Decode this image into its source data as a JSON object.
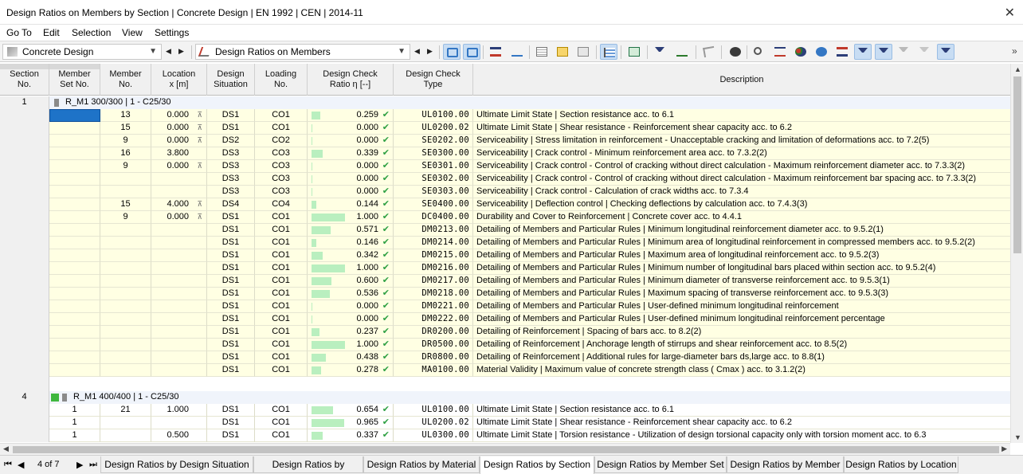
{
  "window": {
    "title": "Design Ratios on Members by Section | Concrete Design | EN 1992 | CEN | 2014-11",
    "close": "✕"
  },
  "menu": [
    "Go To",
    "Edit",
    "Selection",
    "View",
    "Settings"
  ],
  "toolbar": {
    "module": "Concrete Design",
    "result_table": "Design Ratios on Members",
    "overflow": "»"
  },
  "columns": {
    "section": [
      "Section",
      "No."
    ],
    "member_set": [
      "Member",
      "Set No."
    ],
    "member": [
      "Member",
      "No."
    ],
    "location": [
      "Location",
      "x [m]"
    ],
    "design_situation": [
      "Design",
      "Situation"
    ],
    "loading": [
      "Loading",
      "No."
    ],
    "ratio": [
      "Design Check",
      "Ratio η [--]"
    ],
    "type": [
      "Design Check",
      "Type"
    ],
    "description": "Description"
  },
  "groups": [
    {
      "section": "1",
      "label": "R_M1 300/300 | 1 - C25/30",
      "color": ""
    },
    {
      "section": "4",
      "label": "R_M1 400/400 | 1 - C25/30",
      "color": "#3fb73f"
    }
  ],
  "rows_g1": [
    {
      "set": "",
      "member": "13",
      "x": "0.000",
      "xm": "⊼",
      "ds": "DS1",
      "lo": "CO1",
      "ratio": 0.259,
      "r": "0.259",
      "type": "UL0100.00",
      "desc": "Ultimate Limit State | Section resistance acc. to 6.1"
    },
    {
      "set": "",
      "member": "15",
      "x": "0.000",
      "xm": "⊼",
      "ds": "DS1",
      "lo": "CO1",
      "ratio": 0.0,
      "r": "0.000",
      "type": "UL0200.02",
      "desc": "Ultimate Limit State | Shear resistance - Reinforcement shear capacity acc. to 6.2"
    },
    {
      "set": "",
      "member": "9",
      "x": "0.000",
      "xm": "⊼",
      "ds": "DS2",
      "lo": "CO2",
      "ratio": 0.0,
      "r": "0.000",
      "type": "SE0202.00",
      "desc": "Serviceability | Stress limitation in reinforcement - Unacceptable cracking and limitation of deformations acc. to 7.2(5)"
    },
    {
      "set": "",
      "member": "16",
      "x": "3.800",
      "xm": "",
      "ds": "DS3",
      "lo": "CO3",
      "ratio": 0.339,
      "r": "0.339",
      "type": "SE0300.00",
      "desc": "Serviceability | Crack control - Minimum reinforcement area acc. to 7.3.2(2)"
    },
    {
      "set": "",
      "member": "9",
      "x": "0.000",
      "xm": "⊼",
      "ds": "DS3",
      "lo": "CO3",
      "ratio": 0.0,
      "r": "0.000",
      "type": "SE0301.00",
      "desc": "Serviceability | Crack control - Control of cracking without direct calculation - Maximum reinforcement diameter acc. to 7.3.3(2)"
    },
    {
      "set": "",
      "member": "",
      "x": "",
      "xm": "",
      "ds": "DS3",
      "lo": "CO3",
      "ratio": 0.0,
      "r": "0.000",
      "type": "SE0302.00",
      "desc": "Serviceability | Crack control - Control of cracking without direct calculation - Maximum reinforcement bar spacing acc. to 7.3.3(2)"
    },
    {
      "set": "",
      "member": "",
      "x": "",
      "xm": "",
      "ds": "DS3",
      "lo": "CO3",
      "ratio": 0.0,
      "r": "0.000",
      "type": "SE0303.00",
      "desc": "Serviceability | Crack control - Calculation of crack widths acc. to 7.3.4"
    },
    {
      "set": "",
      "member": "15",
      "x": "4.000",
      "xm": "⊼",
      "ds": "DS4",
      "lo": "CO4",
      "ratio": 0.144,
      "r": "0.144",
      "type": "SE0400.00",
      "desc": "Serviceability | Deflection control | Checking deflections by calculation acc. to 7.4.3(3)"
    },
    {
      "set": "",
      "member": "9",
      "x": "0.000",
      "xm": "⊼",
      "ds": "DS1",
      "lo": "CO1",
      "ratio": 1.0,
      "r": "1.000",
      "type": "DC0400.00",
      "desc": "Durability and Cover to Reinforcement | Concrete cover acc. to 4.4.1"
    },
    {
      "set": "",
      "member": "",
      "x": "",
      "xm": "",
      "ds": "DS1",
      "lo": "CO1",
      "ratio": 0.571,
      "r": "0.571",
      "type": "DM0213.00",
      "desc": "Detailing of Members and Particular Rules | Minimum longitudinal reinforcement diameter acc. to 9.5.2(1)"
    },
    {
      "set": "",
      "member": "",
      "x": "",
      "xm": "",
      "ds": "DS1",
      "lo": "CO1",
      "ratio": 0.146,
      "r": "0.146",
      "type": "DM0214.00",
      "desc": "Detailing of Members and Particular Rules | Minimum area of longitudinal reinforcement in compressed members acc. to 9.5.2(2)"
    },
    {
      "set": "",
      "member": "",
      "x": "",
      "xm": "",
      "ds": "DS1",
      "lo": "CO1",
      "ratio": 0.342,
      "r": "0.342",
      "type": "DM0215.00",
      "desc": "Detailing of Members and Particular Rules | Maximum area of longitudinal reinforcement acc. to 9.5.2(3)"
    },
    {
      "set": "",
      "member": "",
      "x": "",
      "xm": "",
      "ds": "DS1",
      "lo": "CO1",
      "ratio": 1.0,
      "r": "1.000",
      "type": "DM0216.00",
      "desc": "Detailing of Members and Particular Rules | Minimum number of longitudinal bars placed within section acc. to 9.5.2(4)"
    },
    {
      "set": "",
      "member": "",
      "x": "",
      "xm": "",
      "ds": "DS1",
      "lo": "CO1",
      "ratio": 0.6,
      "r": "0.600",
      "type": "DM0217.00",
      "desc": "Detailing of Members and Particular Rules | Minimum diameter of transverse reinforcement acc. to 9.5.3(1)"
    },
    {
      "set": "",
      "member": "",
      "x": "",
      "xm": "",
      "ds": "DS1",
      "lo": "CO1",
      "ratio": 0.536,
      "r": "0.536",
      "type": "DM0218.00",
      "desc": "Detailing of Members and Particular Rules | Maximum spacing of transverse reinforcement acc. to 9.5.3(3)"
    },
    {
      "set": "",
      "member": "",
      "x": "",
      "xm": "",
      "ds": "DS1",
      "lo": "CO1",
      "ratio": 0.0,
      "r": "0.000",
      "type": "DM0221.00",
      "desc": "Detailing of Members and Particular Rules | User-defined minimum longitudinal reinforcement"
    },
    {
      "set": "",
      "member": "",
      "x": "",
      "xm": "",
      "ds": "DS1",
      "lo": "CO1",
      "ratio": 0.0,
      "r": "0.000",
      "type": "DM0222.00",
      "desc": "Detailing of Members and Particular Rules | User-defined minimum longitudinal reinforcement percentage"
    },
    {
      "set": "",
      "member": "",
      "x": "",
      "xm": "",
      "ds": "DS1",
      "lo": "CO1",
      "ratio": 0.237,
      "r": "0.237",
      "type": "DR0200.00",
      "desc": "Detailing of Reinforcement | Spacing of bars acc. to 8.2(2)"
    },
    {
      "set": "",
      "member": "",
      "x": "",
      "xm": "",
      "ds": "DS1",
      "lo": "CO1",
      "ratio": 1.0,
      "r": "1.000",
      "type": "DR0500.00",
      "desc": "Detailing of Reinforcement | Anchorage length of stirrups and shear reinforcement acc. to 8.5(2)"
    },
    {
      "set": "",
      "member": "",
      "x": "",
      "xm": "",
      "ds": "DS1",
      "lo": "CO1",
      "ratio": 0.438,
      "r": "0.438",
      "type": "DR0800.00",
      "desc": "Detailing of Reinforcement | Additional rules for large-diameter bars ds,large acc. to 8.8(1)"
    },
    {
      "set": "",
      "member": "",
      "x": "",
      "xm": "",
      "ds": "DS1",
      "lo": "CO1",
      "ratio": 0.278,
      "r": "0.278",
      "type": "MA0100.00",
      "desc": "Material Validity | Maximum value of concrete strength class ( Cmax ) acc. to 3.1.2(2)"
    }
  ],
  "rows_g2": [
    {
      "set": "1",
      "member": "21",
      "x": "1.000",
      "xm": "",
      "ds": "DS1",
      "lo": "CO1",
      "ratio": 0.654,
      "r": "0.654",
      "type": "UL0100.00",
      "desc": "Ultimate Limit State | Section resistance acc. to 6.1"
    },
    {
      "set": "1",
      "member": "",
      "x": "",
      "xm": "",
      "ds": "DS1",
      "lo": "CO1",
      "ratio": 0.965,
      "r": "0.965",
      "type": "UL0200.02",
      "desc": "Ultimate Limit State | Shear resistance - Reinforcement shear capacity acc. to 6.2"
    },
    {
      "set": "1",
      "member": "",
      "x": "0.500",
      "xm": "",
      "ds": "DS1",
      "lo": "CO1",
      "ratio": 0.337,
      "r": "0.337",
      "type": "UL0300.00",
      "desc": "Ultimate Limit State | Torsion resistance - Utilization of design torsional capacity only with torsion moment acc. to 6.3"
    }
  ],
  "pager": {
    "text": "4 of 7",
    "first": "⏮",
    "prev": "◀",
    "next": "▶",
    "last": "⏭"
  },
  "tabs": [
    "Design Ratios by Design Situation",
    "Design Ratios by Loading",
    "Design Ratios by Material",
    "Design Ratios by Section",
    "Design Ratios by Member Set",
    "Design Ratios by Member",
    "Design Ratios by Location"
  ],
  "active_tab": 3
}
